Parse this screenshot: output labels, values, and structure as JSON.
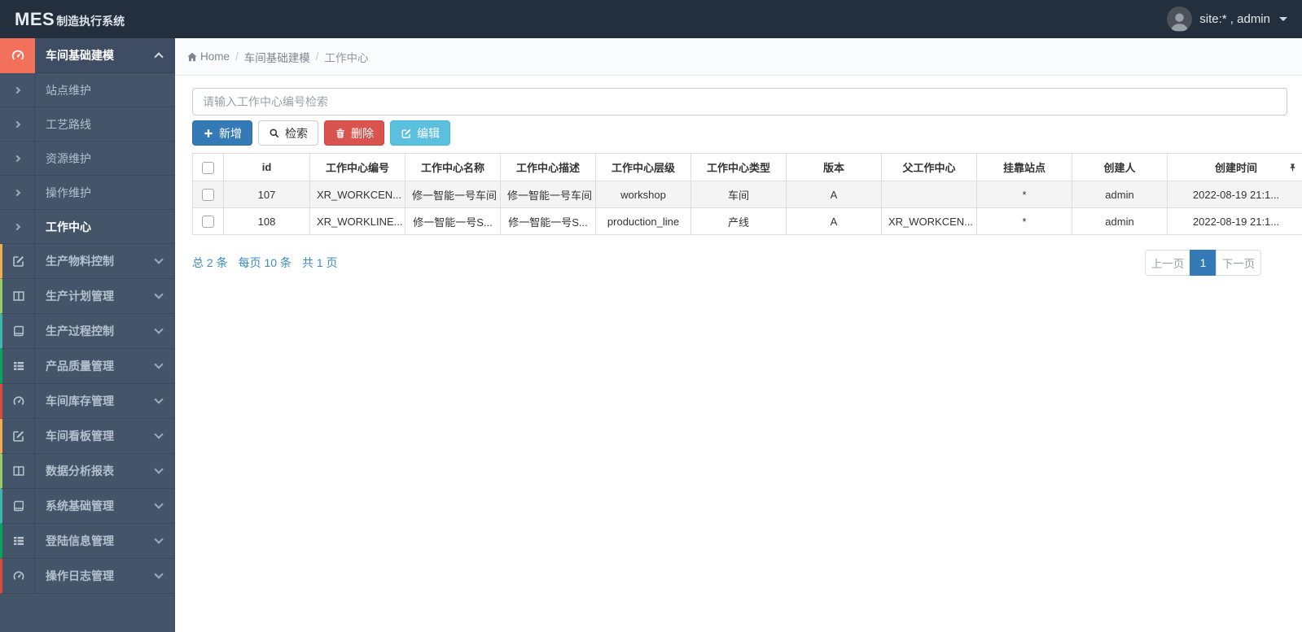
{
  "navbar": {
    "brand_primary": "MES",
    "brand_secondary": "制造执行系统",
    "user_label": "site:* , admin",
    "avatar_icon": "user-photo-avatar",
    "background_color": "#242f3e"
  },
  "breadcrumb": {
    "home_icon": "home-icon",
    "home": "Home",
    "section": "车间基础建模",
    "current": "工作中心"
  },
  "sidebar": {
    "background_color": "#455569",
    "group": {
      "label": "车间基础建模",
      "icon": "gauge-icon",
      "accent": "#f3705a",
      "expanded": true
    },
    "submenu": [
      {
        "label": "站点维护",
        "active": false
      },
      {
        "label": "工艺路线",
        "active": false
      },
      {
        "label": "资源维护",
        "active": false
      },
      {
        "label": "操作维护",
        "active": false
      },
      {
        "label": "工作中心",
        "active": true
      }
    ],
    "items": [
      {
        "label": "生产物料控制",
        "icon": "pencil-square-icon",
        "strip": "#f0ad4e"
      },
      {
        "label": "生产计划管理",
        "icon": "columns-icon",
        "strip": "#9ccc65"
      },
      {
        "label": "生产过程控制",
        "icon": "book-icon",
        "strip": "#3eb6ad"
      },
      {
        "label": "产品质量管理",
        "icon": "list-icon",
        "strip": "#00a65a"
      },
      {
        "label": "车间库存管理",
        "icon": "gauge-icon",
        "strip": "#dd4b39"
      },
      {
        "label": "车间看板管理",
        "icon": "pencil-square-icon",
        "strip": "#f0ad4e"
      },
      {
        "label": "数据分析报表",
        "icon": "columns-icon",
        "strip": "#9ccc65"
      },
      {
        "label": "系统基础管理",
        "icon": "book-icon",
        "strip": "#3eb6ad"
      },
      {
        "label": "登陆信息管理",
        "icon": "list-icon",
        "strip": "#00a65a"
      },
      {
        "label": "操作日志管理",
        "icon": "gauge-icon",
        "strip": "#dd4b39"
      }
    ]
  },
  "toolbar": {
    "search_placeholder": "请输入工作中心编号检索",
    "add_label": "新增",
    "add_icon": "plus-icon",
    "add_color": "#337ab7",
    "search_label": "检索",
    "search_icon": "search-icon",
    "delete_label": "删除",
    "delete_icon": "trash-icon",
    "delete_color": "#d9534f",
    "edit_label": "编辑",
    "edit_icon": "edit-icon",
    "edit_color": "#5bc0de"
  },
  "table": {
    "columns": [
      "id",
      "工作中心编号",
      "工作中心名称",
      "工作中心描述",
      "工作中心层级",
      "工作中心类型",
      "版本",
      "父工作中心",
      "挂靠站点",
      "创建人",
      "创建时间"
    ],
    "pin_icon": "pin-column-icon",
    "rows": [
      {
        "cells": [
          "107",
          "XR_WORKCEN...",
          "修一智能一号车间",
          "修一智能一号车间",
          "workshop",
          "车间",
          "A",
          "",
          "*",
          "admin",
          "2022-08-19 21:1..."
        ]
      },
      {
        "cells": [
          "108",
          "XR_WORKLINE...",
          "修一智能一号S...",
          "修一智能一号S...",
          "production_line",
          "产线",
          "A",
          "XR_WORKCEN...",
          "*",
          "admin",
          "2022-08-19 21:1..."
        ]
      }
    ]
  },
  "pagination": {
    "total_text": "总 2 条",
    "per_page_text": "每页 10 条",
    "pages_text": "共 1 页",
    "prev_label": "上一页",
    "current_page": "1",
    "next_label": "下一页",
    "active_color": "#337ab7"
  }
}
